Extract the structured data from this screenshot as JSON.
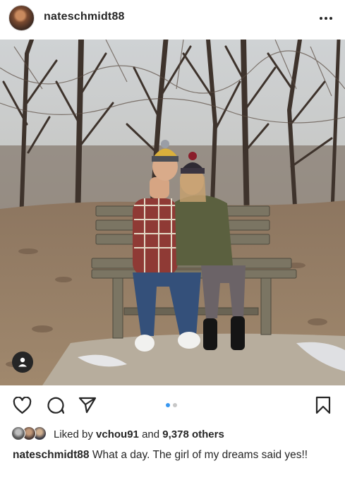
{
  "post": {
    "username": "nateschmidt88",
    "avatar_icon": "profile-avatar",
    "more_icon": "more-options-icon",
    "photo_description_icon": "photo",
    "carousel": {
      "count": 2,
      "active_index": 0
    },
    "likes": {
      "prefix": "Liked by",
      "user": "vchou91",
      "conjunction": "and",
      "others": "9,378 others"
    },
    "caption": {
      "username": "nateschmidt88",
      "text": "What a day. The girl of my dreams said yes!!"
    }
  },
  "colors": {
    "text": "#262626",
    "carousel_active": "#3897f0",
    "carousel_inactive": "#c7c7c7",
    "background": "#ffffff"
  }
}
